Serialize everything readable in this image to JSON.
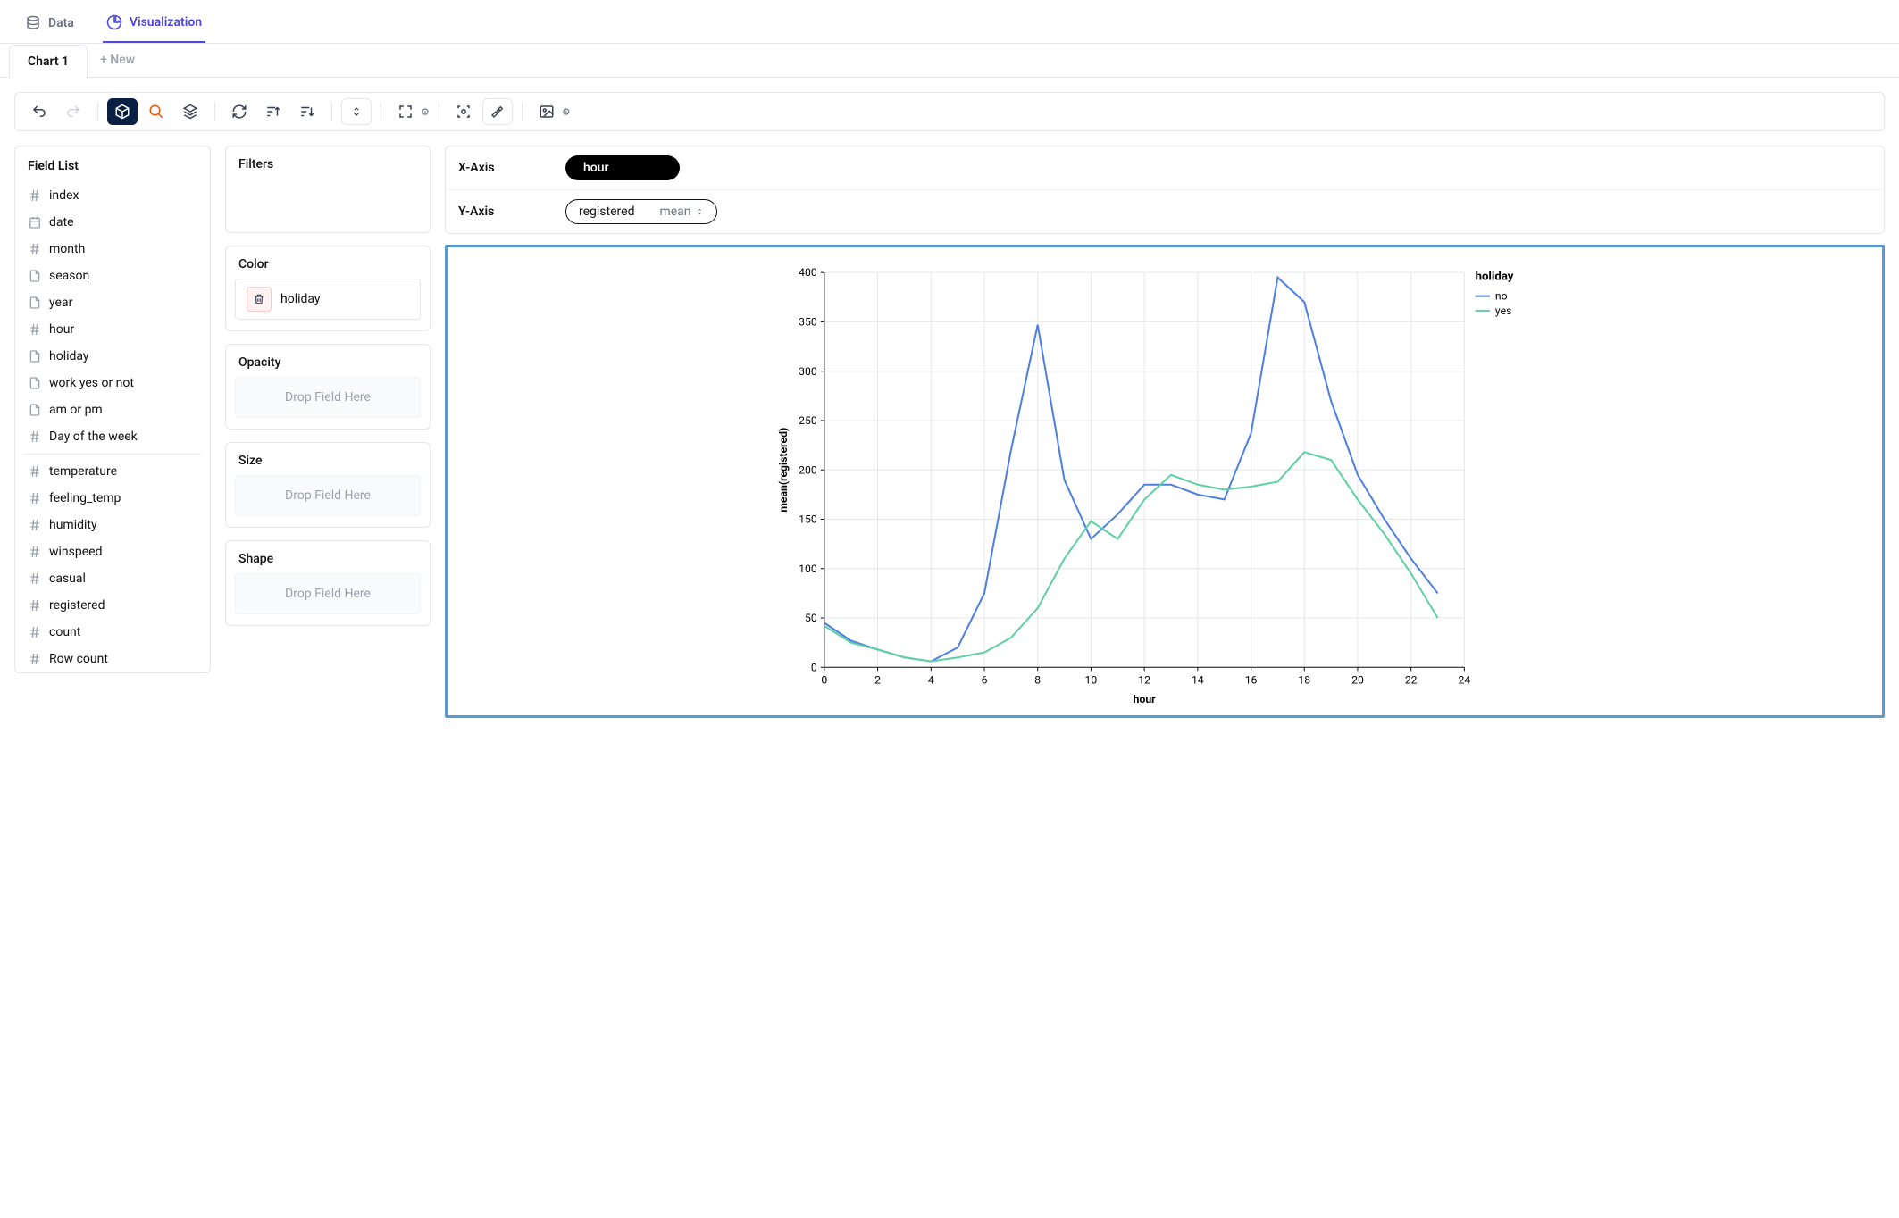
{
  "top_tabs": {
    "data": "Data",
    "viz": "Visualization"
  },
  "chart_tabs": {
    "current": "Chart 1",
    "new": "+ New"
  },
  "field_list": {
    "title": "Field List",
    "group1": [
      {
        "icon": "hash",
        "label": "index"
      },
      {
        "icon": "cal",
        "label": "date"
      },
      {
        "icon": "hash",
        "label": "month"
      },
      {
        "icon": "doc",
        "label": "season"
      },
      {
        "icon": "doc",
        "label": "year"
      },
      {
        "icon": "hash",
        "label": "hour"
      },
      {
        "icon": "doc",
        "label": "holiday"
      },
      {
        "icon": "doc",
        "label": "work yes or not"
      },
      {
        "icon": "doc",
        "label": "am or pm"
      },
      {
        "icon": "hash",
        "label": "Day of the week"
      }
    ],
    "group2": [
      {
        "icon": "hash",
        "label": "temperature"
      },
      {
        "icon": "hash",
        "label": "feeling_temp"
      },
      {
        "icon": "hash",
        "label": "humidity"
      },
      {
        "icon": "hash",
        "label": "winspeed"
      },
      {
        "icon": "hash",
        "label": "casual"
      },
      {
        "icon": "hash",
        "label": "registered"
      },
      {
        "icon": "hash",
        "label": "count"
      },
      {
        "icon": "hash",
        "label": "Row count"
      }
    ]
  },
  "config": {
    "filters": "Filters",
    "color": "Color",
    "color_field": "holiday",
    "opacity": "Opacity",
    "size": "Size",
    "shape": "Shape",
    "drop": "Drop Field Here"
  },
  "axes": {
    "x_label": "X-Axis",
    "x_field": "hour",
    "y_label": "Y-Axis",
    "y_field": "registered",
    "y_agg": "mean"
  },
  "legend": {
    "title": "holiday",
    "items": [
      "no",
      "yes"
    ]
  },
  "chart_data": {
    "type": "line",
    "title": "",
    "xlabel": "hour",
    "ylabel": "mean(registered)",
    "xlim": [
      0,
      24
    ],
    "ylim": [
      0,
      400
    ],
    "x_ticks": [
      0,
      2,
      4,
      6,
      8,
      10,
      12,
      14,
      16,
      18,
      20,
      22,
      24
    ],
    "y_ticks": [
      0,
      50,
      100,
      150,
      200,
      250,
      300,
      350,
      400
    ],
    "x": [
      0,
      1,
      2,
      3,
      4,
      5,
      6,
      7,
      8,
      9,
      10,
      11,
      12,
      13,
      14,
      15,
      16,
      17,
      18,
      19,
      20,
      21,
      22,
      23
    ],
    "series": [
      {
        "name": "no",
        "color": "#4f7fe3",
        "values": [
          45,
          27,
          18,
          10,
          6,
          20,
          75,
          220,
          347,
          190,
          130,
          155,
          185,
          185,
          175,
          170,
          237,
          395,
          370,
          270,
          195,
          150,
          110,
          75
        ]
      },
      {
        "name": "yes",
        "color": "#5fd0a3",
        "values": [
          42,
          25,
          18,
          10,
          6,
          10,
          15,
          30,
          60,
          110,
          148,
          130,
          170,
          195,
          185,
          180,
          183,
          188,
          218,
          210,
          170,
          135,
          95,
          50
        ]
      }
    ],
    "legend_title": "holiday"
  }
}
